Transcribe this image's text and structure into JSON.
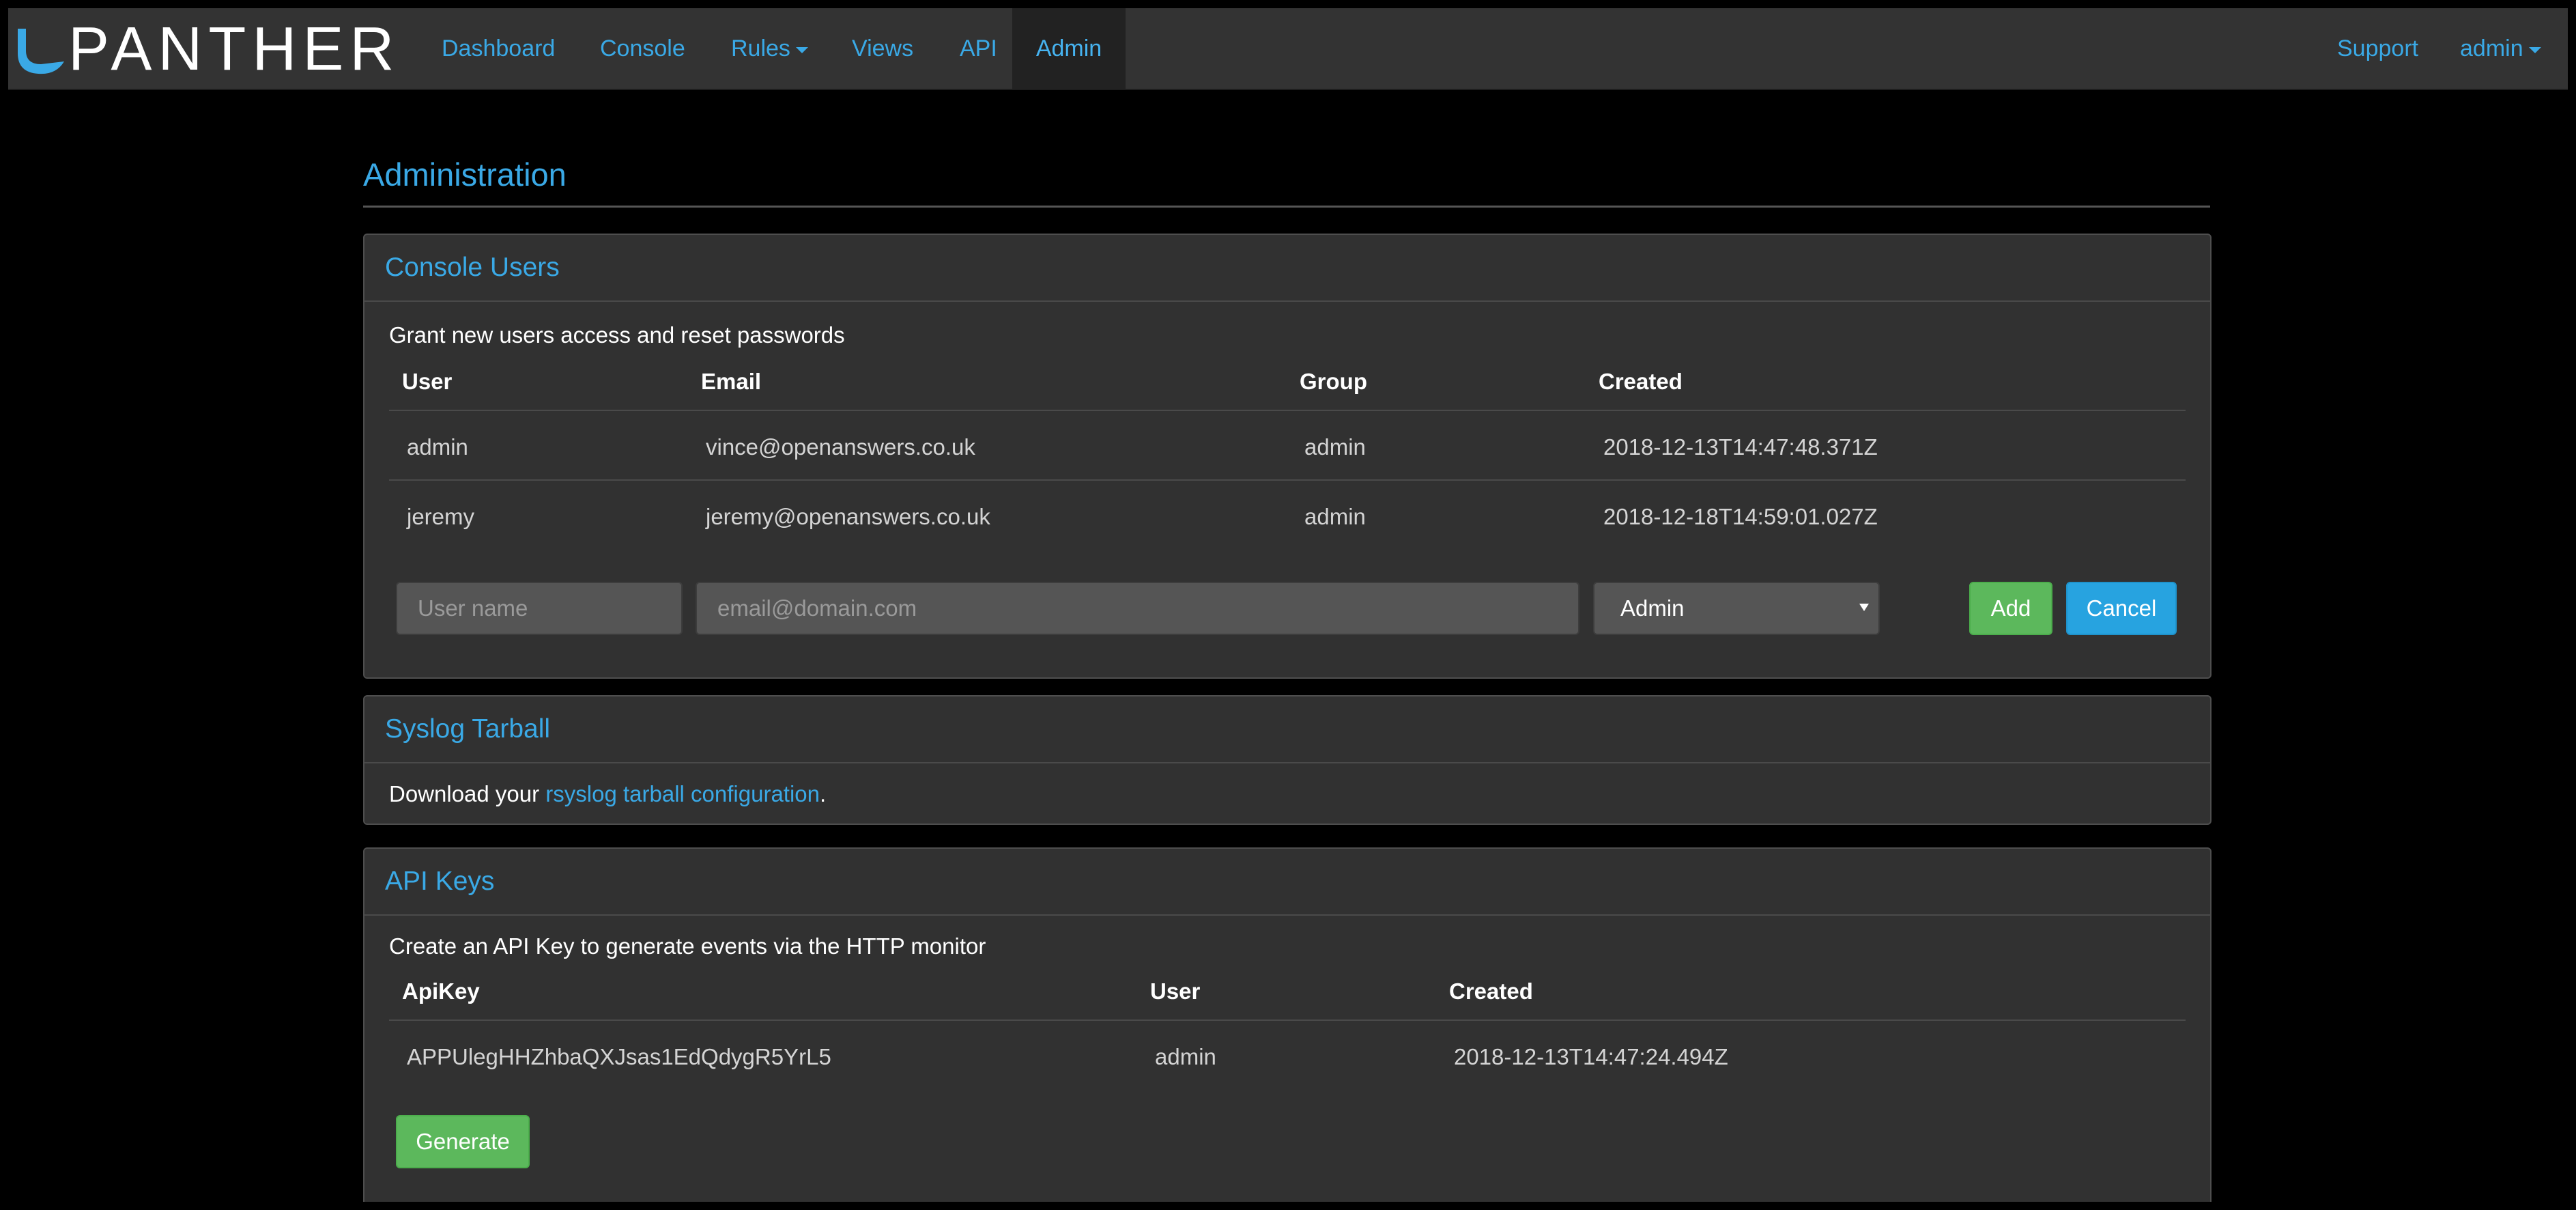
{
  "app": {
    "brand": "PANTHER"
  },
  "nav": {
    "dashboard": "Dashboard",
    "console": "Console",
    "rules": "Rules",
    "views": "Views",
    "api": "API",
    "admin": "Admin",
    "support": "Support",
    "user": "admin"
  },
  "page": {
    "title": "Administration"
  },
  "console_users": {
    "title": "Console Users",
    "description": "Grant new users access and reset passwords",
    "columns": [
      "User",
      "Email",
      "Group",
      "Created"
    ],
    "rows": [
      {
        "user": "admin",
        "email": "vince@openanswers.co.uk",
        "group": "admin",
        "created": "2018-12-13T14:47:48.371Z"
      },
      {
        "user": "jeremy",
        "email": "jeremy@openanswers.co.uk",
        "group": "admin",
        "created": "2018-12-18T14:59:01.027Z"
      }
    ],
    "form": {
      "username_placeholder": "User name",
      "email_placeholder": "email@domain.com",
      "group_value": "Admin",
      "add_label": "Add",
      "cancel_label": "Cancel"
    }
  },
  "syslog": {
    "title": "Syslog Tarball",
    "prefix": "Download your ",
    "link": "rsyslog tarball configuration",
    "suffix": "."
  },
  "api_keys": {
    "title": "API Keys",
    "description": "Create an API Key to generate events via the HTTP monitor",
    "columns": [
      "ApiKey",
      "User",
      "Created"
    ],
    "rows": [
      {
        "key": "APPUlegHHZhbaQXJsas1EdQdygR5YrL5",
        "user": "admin",
        "created": "2018-12-13T14:47:24.494Z"
      }
    ],
    "generate_label": "Generate"
  },
  "colors": {
    "accent": "#3aa9e6",
    "navbar": "#333333",
    "panel": "#313131",
    "success": "#5cb85c",
    "info": "#27a3e0"
  }
}
